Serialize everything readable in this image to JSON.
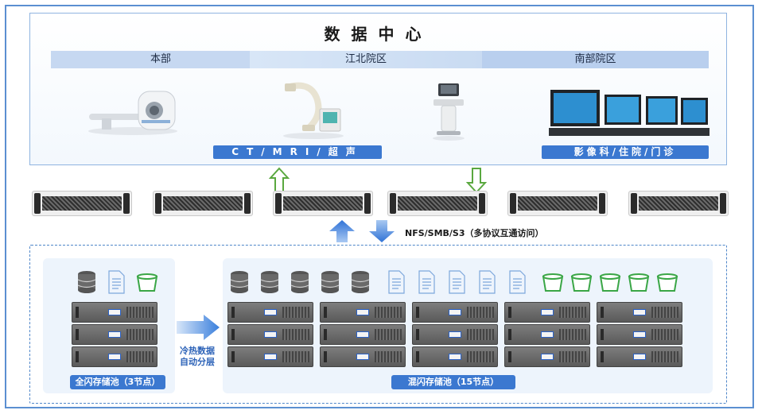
{
  "data_center": {
    "title": "数据中心",
    "campuses": [
      "本部",
      "江北院区",
      "南部院区"
    ],
    "banner_left": "CT/MRI/超声",
    "banner_right": "影像科/住院/门诊"
  },
  "protocol_text": "NFS/SMB/S3（多协议互通访问）",
  "storage": {
    "all_flash_label": "全闪存储池（3节点）",
    "hybrid_label": "混闪存储池（15节点）",
    "tiering_text_line1": "冷热数据",
    "tiering_text_line2": "自动分层"
  },
  "icons": {
    "database": "database-icon",
    "file": "file-icon",
    "bucket": "bucket-icon"
  },
  "colors": {
    "accent_blue": "#3b78d0",
    "green_arrow": "#5aa83f",
    "bucket_green": "#3aa646"
  }
}
